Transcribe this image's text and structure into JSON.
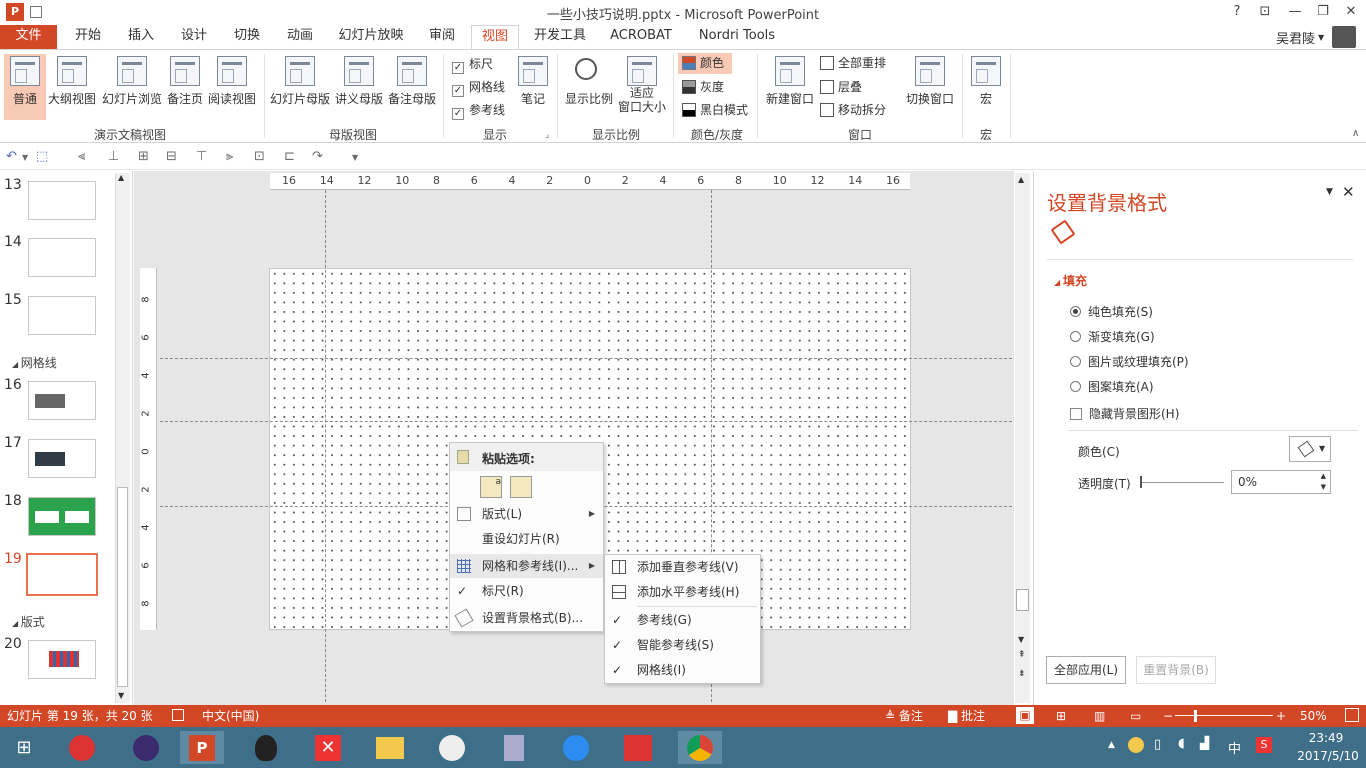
{
  "window": {
    "title": "一些小技巧说明.pptx - Microsoft PowerPoint",
    "help": "?",
    "min": "—",
    "restore": "❐",
    "close": "✕",
    "user": "吴君陵"
  },
  "tabs": [
    {
      "label": "文件"
    },
    {
      "label": "开始"
    },
    {
      "label": "插入"
    },
    {
      "label": "设计"
    },
    {
      "label": "切换"
    },
    {
      "label": "动画"
    },
    {
      "label": "幻灯片放映"
    },
    {
      "label": "审阅"
    },
    {
      "label": "视图"
    },
    {
      "label": "开发工具"
    },
    {
      "label": "ACROBAT"
    },
    {
      "label": "Nordri Tools"
    }
  ],
  "ribbon": {
    "presentation_views": {
      "label": "演示文稿视图",
      "buttons": [
        "普通",
        "大纲视图",
        "幻灯片浏览",
        "备注页",
        "阅读视图"
      ]
    },
    "master_views": {
      "label": "母版视图",
      "buttons": [
        "幻灯片母版",
        "讲义母版",
        "备注母版"
      ]
    },
    "show": {
      "label": "显示",
      "ruler": "标尺",
      "gridlines": "网格线",
      "guides": "参考线",
      "notes": "笔记"
    },
    "zoom": {
      "label": "显示比例",
      "zoom": "显示比例",
      "fit_line1": "适应",
      "fit_line2": "窗口大小"
    },
    "color": {
      "label": "颜色/灰度",
      "color": "颜色",
      "grayscale": "灰度",
      "bw": "黑白模式"
    },
    "window": {
      "label": "窗口",
      "new_window": "新建窗口",
      "arrange_all": "全部重排",
      "cascade": "层叠",
      "move_split": "移动拆分",
      "switch": "切换窗口"
    },
    "macros": {
      "label": "宏",
      "macros": "宏"
    }
  },
  "thumbs": {
    "numbers": [
      "13",
      "14",
      "15",
      "16",
      "17",
      "18",
      "19",
      "20"
    ],
    "sections": [
      "网格线",
      "版式"
    ]
  },
  "ruler": {
    "h_ticks": [
      "16",
      "14",
      "12",
      "10",
      "8",
      "6",
      "4",
      "2",
      "0",
      "2",
      "4",
      "6",
      "8",
      "10",
      "12",
      "14",
      "16"
    ],
    "v_ticks": [
      "8",
      "6",
      "4",
      "2",
      "0",
      "2",
      "4",
      "6",
      "8"
    ]
  },
  "context_menu": {
    "paste_header": "粘贴选项:",
    "layout": "版式(L)",
    "reset": "重设幻灯片(R)",
    "grid": "网格和参考线(I)...",
    "ruler": "标尺(R)",
    "format_bg": "设置背景格式(B)..."
  },
  "submenu": {
    "add_vertical": "添加垂直参考线(V)",
    "add_horizontal": "添加水平参考线(H)",
    "guides": "参考线(G)",
    "smart_guides": "智能参考线(S)",
    "gridlines": "网格线(I)"
  },
  "pane": {
    "title": "设置背景格式",
    "fill_section": "填充",
    "options": [
      "纯色填充(S)",
      "渐变填充(G)",
      "图片或纹理填充(P)",
      "图案填充(A)"
    ],
    "hide_graphics": "隐藏背景图形(H)",
    "color_label": "颜色(C)",
    "transparency_label": "透明度(T)",
    "transparency_value": "0%",
    "apply_all": "全部应用(L)",
    "reset_bg": "重置背景(B)"
  },
  "status": {
    "slide_info": "幻灯片 第 19 张，共 20 张",
    "language": "中文(中国)",
    "notes": "备注",
    "comments": "批注",
    "zoom": "50%"
  },
  "taskbar": {
    "time": "23:49",
    "date": "2017/5/10",
    "ime": "中"
  },
  "colors": {
    "accent": "#d24726",
    "taskbar": "#3f6e88"
  }
}
